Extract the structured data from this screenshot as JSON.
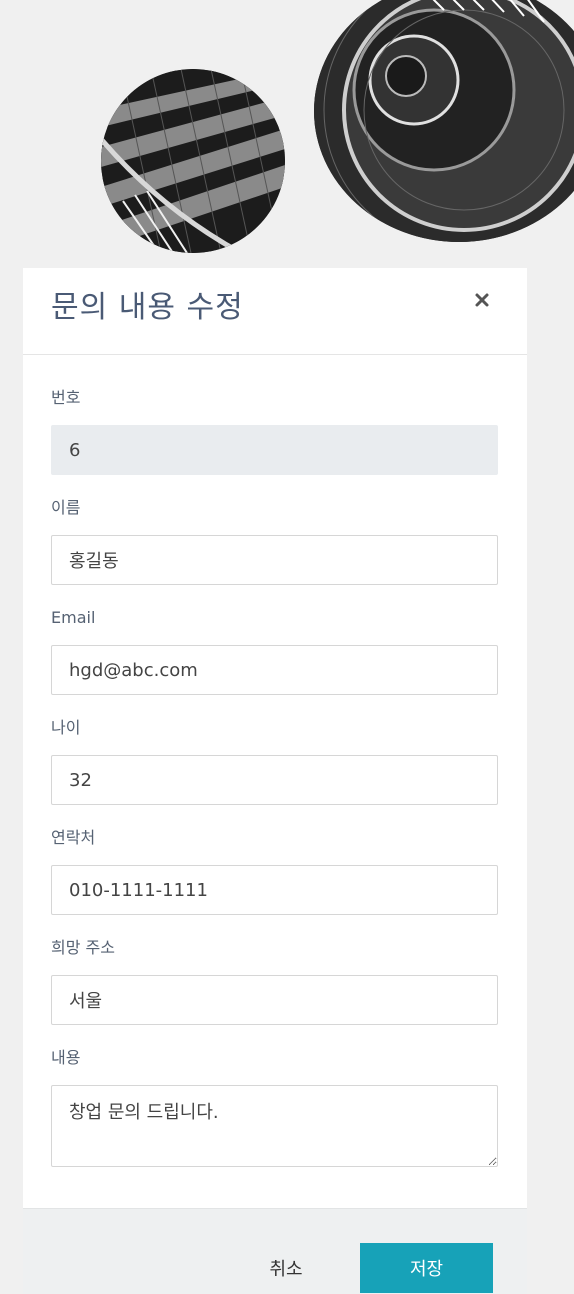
{
  "modal": {
    "title": "문의 내용 수정",
    "close_icon": "close-icon"
  },
  "form": {
    "number": {
      "label": "번호",
      "value": "6"
    },
    "name": {
      "label": "이름",
      "value": "홍길동"
    },
    "email": {
      "label": "Email",
      "value": "hgd@abc.com"
    },
    "age": {
      "label": "나이",
      "value": "32"
    },
    "phone": {
      "label": "연락처",
      "value": "010-1111-1111"
    },
    "address": {
      "label": "희망 주소",
      "value": "서울"
    },
    "content": {
      "label": "내용",
      "value": "창업 문의 드립니다."
    }
  },
  "footer": {
    "cancel_label": "취소",
    "save_label": "저장"
  },
  "colors": {
    "title": "#4a5a75",
    "save_button": "#17a2b8",
    "footer_bg": "#eef0f1",
    "readonly_bg": "#e9ecef"
  }
}
